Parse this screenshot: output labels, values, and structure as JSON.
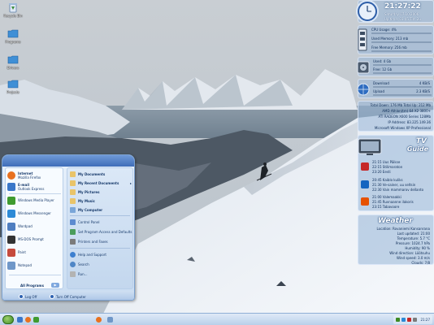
{
  "desktop": {
    "icons": [
      {
        "label": "Recycle Bin",
        "icon": "recycle-bin-icon"
      },
      {
        "label": "Programs",
        "icon": "folder-icon"
      },
      {
        "label": "Drivers",
        "icon": "folder-icon"
      },
      {
        "label": "Projects",
        "icon": "folder-icon"
      }
    ]
  },
  "clock_gadget": {
    "time": "21:27:22",
    "date": "Saturday 07.10.2006",
    "uptime": "Up time: 01:45  Tim 2u"
  },
  "system_monitor": {
    "cpu": {
      "label": "CPU Usage: 4%",
      "value": 0.04
    },
    "ram": {
      "label": "Used Memory: 213 mb",
      "value": 0.42
    },
    "free_memory": {
      "label": "Free Memory: 256 mb",
      "value": 0.5
    },
    "disk_used": {
      "label": "Used: 4 Gb",
      "value": 0.25
    },
    "disk_free": {
      "label": "Free: 12 Gb",
      "value": 0.75
    },
    "download": {
      "label": "Download",
      "value_text": "4 KB/S",
      "value": 0.1
    },
    "upload": {
      "label": "Upload",
      "value_text": "2.3 KB/S",
      "value": 0.05
    },
    "totals": "Total Down: 176 Mb  Total Up: 212 Mb",
    "cpu_name": "AMD Athlon(tm) 64 X2 3800+",
    "gpu_name": "ATI RADEON X600 Series 128Mb",
    "ip": "IP Address: 83.225.149.36",
    "os": "Microsoft Windows XP Professional"
  },
  "tv_guide": {
    "title_line1": "TV",
    "title_line2": "Guide",
    "channels": [
      {
        "icon": "channel-red-icon",
        "color": "#c62828",
        "lines": [
          "21:15  Uus Päikse",
          "22:15  Stilimaraton",
          "23:20  Eesti"
        ]
      },
      {
        "icon": "channel-blue-icon",
        "color": "#1565c0",
        "lines": [
          "20:45  Kaiblo kuliks",
          "21:30  Ve-sainer, uu seltsin",
          "22:30  Vain mammarov dellanto"
        ]
      },
      {
        "icon": "channel-orange-icon",
        "color": "#e65100",
        "lines": [
          "21:00  Valemaakki",
          "21:45  Ruvnaanne ilakoris",
          "23:15  Tabavoore"
        ]
      }
    ]
  },
  "weather": {
    "title": "Weather",
    "lines": [
      "Location: Rovaniemi Kansanrana",
      "Last updated: 21:00",
      "Temperature: 5.7 °C",
      "Pressure: 1024.7 hPa",
      "Humidity: 90 %",
      "Wind direction: Lõõtsuhu",
      "Wind speed: 3.0 m/s",
      "Clouds: 7/8"
    ]
  },
  "start_menu": {
    "pinned": [
      {
        "label": "Internet",
        "sub": "Mozilla Firefox",
        "color": "#e8711f"
      },
      {
        "label": "E-mail",
        "sub": "Outlook Express",
        "color": "#3a77c9"
      }
    ],
    "recent": [
      {
        "label": "Windows Media Player",
        "color": "#3f9b2f"
      },
      {
        "label": "Windows Messenger",
        "color": "#2d8ad6"
      },
      {
        "label": "Wordpad",
        "color": "#4f7ec0"
      },
      {
        "label": "MS-DOS Prompt",
        "color": "#333333"
      },
      {
        "label": "Paint",
        "color": "#c64a3c"
      },
      {
        "label": "Notepad",
        "color": "#6f97c8"
      }
    ],
    "all_programs": "All Programs",
    "right_items": [
      {
        "label": "My Documents",
        "bold": true,
        "color": "#e9c46a"
      },
      {
        "label": "My Recent Documents",
        "bold": true,
        "color": "#e9c46a",
        "arrow": "▸"
      },
      {
        "label": "My Pictures",
        "bold": true,
        "color": "#e9c46a"
      },
      {
        "label": "My Music",
        "bold": true,
        "color": "#e9c46a"
      },
      {
        "label": "My Computer",
        "bold": true,
        "color": "#7aa6d8"
      },
      {
        "label": "Control Panel",
        "bold": false,
        "color": "#5d8bd0"
      },
      {
        "label": "Set Program Access and Defaults",
        "bold": false,
        "color": "#4b9d5b"
      },
      {
        "label": "Printers and Faxes",
        "bold": false,
        "color": "#7b7b7b"
      },
      {
        "label": "Help and Support",
        "bold": false,
        "color": "#3d7fcf"
      },
      {
        "label": "Search",
        "bold": false,
        "color": "#4f86c6"
      },
      {
        "label": "Run...",
        "bold": false,
        "color": "#b3b3b3"
      }
    ],
    "logoff": "Log Off",
    "turnoff": "Turn Off Computer"
  },
  "taskbar": {
    "tray_time": "21:27"
  },
  "colors": {
    "sky": "#c4ccd3",
    "snow": "#eef2f6",
    "accent": "#2f6fc2"
  }
}
